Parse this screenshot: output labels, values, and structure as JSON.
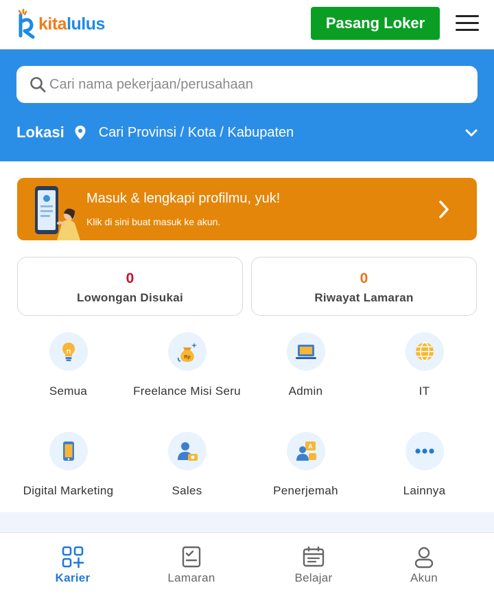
{
  "header": {
    "logo_text_a": "kita",
    "logo_text_b": "lulus",
    "post_job_label": "Pasang Loker"
  },
  "search": {
    "placeholder": "Cari nama pekerjaan/perusahaan",
    "location_label": "Lokasi",
    "location_placeholder": "Cari Provinsi / Kota / Kabupaten"
  },
  "banner": {
    "title": "Masuk & lengkapi profilmu, yuk!",
    "subtitle": "Klik di sini buat masuk ke akun."
  },
  "stats": [
    {
      "value": "0",
      "label": "Lowongan Disukai",
      "color": "#c8102e"
    },
    {
      "value": "0",
      "label": "Riwayat Lamaran",
      "color": "#e8741a"
    }
  ],
  "categories": [
    {
      "label": "Semua",
      "icon": "lightbulb-icon"
    },
    {
      "label": "Freelance Misi Seru",
      "icon": "money-bag-icon"
    },
    {
      "label": "Admin",
      "icon": "laptop-icon"
    },
    {
      "label": "IT",
      "icon": "globe-icon"
    },
    {
      "label": "Digital Marketing",
      "icon": "smartphone-icon"
    },
    {
      "label": "Sales",
      "icon": "salesperson-icon"
    },
    {
      "label": "Penerjemah",
      "icon": "translator-icon"
    },
    {
      "label": "Lainnya",
      "icon": "more-dots-icon"
    }
  ],
  "bottom_nav": [
    {
      "label": "Karier",
      "icon": "grid-plus-icon",
      "active": true
    },
    {
      "label": "Lamaran",
      "icon": "clipboard-check-icon",
      "active": false
    },
    {
      "label": "Belajar",
      "icon": "calendar-icon",
      "active": false
    },
    {
      "label": "Akun",
      "icon": "user-icon",
      "active": false
    }
  ],
  "colors": {
    "brand_blue": "#2b8ee6",
    "brand_orange": "#ef7d1a",
    "banner_orange": "#e4860a",
    "post_button_green": "#0a9f24",
    "active_nav": "#1f79d9"
  }
}
